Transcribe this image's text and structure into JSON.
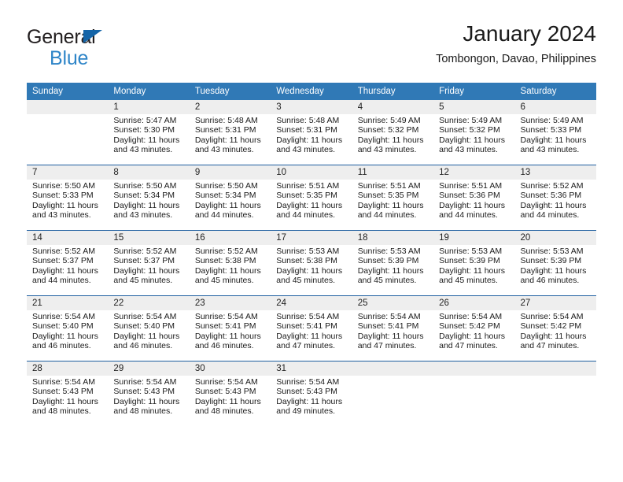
{
  "logo": {
    "word1": "General",
    "word2": "Blue",
    "triangle_icon": "blue-triangle-icon",
    "color_dark": "#231f20",
    "color_blue": "#2e85c8"
  },
  "header": {
    "title": "January 2024",
    "subtitle": "Tombongon, Davao, Philippines"
  },
  "theme": {
    "header_bg": "#3079b6",
    "separator": "#1f5fa0",
    "daynum_bg": "#eeeeee",
    "cell_bg": "#ffffff"
  },
  "calendar": {
    "weekdays": [
      "Sunday",
      "Monday",
      "Tuesday",
      "Wednesday",
      "Thursday",
      "Friday",
      "Saturday"
    ],
    "labels": {
      "sunrise": "Sunrise:",
      "sunset": "Sunset:",
      "daylight": "Daylight:"
    },
    "weeks": [
      [
        {
          "day": "",
          "sunrise": "",
          "sunset": "",
          "daylight1": "",
          "daylight2": ""
        },
        {
          "day": "1",
          "sunrise": "Sunrise: 5:47 AM",
          "sunset": "Sunset: 5:30 PM",
          "daylight1": "Daylight: 11 hours",
          "daylight2": "and 43 minutes."
        },
        {
          "day": "2",
          "sunrise": "Sunrise: 5:48 AM",
          "sunset": "Sunset: 5:31 PM",
          "daylight1": "Daylight: 11 hours",
          "daylight2": "and 43 minutes."
        },
        {
          "day": "3",
          "sunrise": "Sunrise: 5:48 AM",
          "sunset": "Sunset: 5:31 PM",
          "daylight1": "Daylight: 11 hours",
          "daylight2": "and 43 minutes."
        },
        {
          "day": "4",
          "sunrise": "Sunrise: 5:49 AM",
          "sunset": "Sunset: 5:32 PM",
          "daylight1": "Daylight: 11 hours",
          "daylight2": "and 43 minutes."
        },
        {
          "day": "5",
          "sunrise": "Sunrise: 5:49 AM",
          "sunset": "Sunset: 5:32 PM",
          "daylight1": "Daylight: 11 hours",
          "daylight2": "and 43 minutes."
        },
        {
          "day": "6",
          "sunrise": "Sunrise: 5:49 AM",
          "sunset": "Sunset: 5:33 PM",
          "daylight1": "Daylight: 11 hours",
          "daylight2": "and 43 minutes."
        }
      ],
      [
        {
          "day": "7",
          "sunrise": "Sunrise: 5:50 AM",
          "sunset": "Sunset: 5:33 PM",
          "daylight1": "Daylight: 11 hours",
          "daylight2": "and 43 minutes."
        },
        {
          "day": "8",
          "sunrise": "Sunrise: 5:50 AM",
          "sunset": "Sunset: 5:34 PM",
          "daylight1": "Daylight: 11 hours",
          "daylight2": "and 43 minutes."
        },
        {
          "day": "9",
          "sunrise": "Sunrise: 5:50 AM",
          "sunset": "Sunset: 5:34 PM",
          "daylight1": "Daylight: 11 hours",
          "daylight2": "and 44 minutes."
        },
        {
          "day": "10",
          "sunrise": "Sunrise: 5:51 AM",
          "sunset": "Sunset: 5:35 PM",
          "daylight1": "Daylight: 11 hours",
          "daylight2": "and 44 minutes."
        },
        {
          "day": "11",
          "sunrise": "Sunrise: 5:51 AM",
          "sunset": "Sunset: 5:35 PM",
          "daylight1": "Daylight: 11 hours",
          "daylight2": "and 44 minutes."
        },
        {
          "day": "12",
          "sunrise": "Sunrise: 5:51 AM",
          "sunset": "Sunset: 5:36 PM",
          "daylight1": "Daylight: 11 hours",
          "daylight2": "and 44 minutes."
        },
        {
          "day": "13",
          "sunrise": "Sunrise: 5:52 AM",
          "sunset": "Sunset: 5:36 PM",
          "daylight1": "Daylight: 11 hours",
          "daylight2": "and 44 minutes."
        }
      ],
      [
        {
          "day": "14",
          "sunrise": "Sunrise: 5:52 AM",
          "sunset": "Sunset: 5:37 PM",
          "daylight1": "Daylight: 11 hours",
          "daylight2": "and 44 minutes."
        },
        {
          "day": "15",
          "sunrise": "Sunrise: 5:52 AM",
          "sunset": "Sunset: 5:37 PM",
          "daylight1": "Daylight: 11 hours",
          "daylight2": "and 45 minutes."
        },
        {
          "day": "16",
          "sunrise": "Sunrise: 5:52 AM",
          "sunset": "Sunset: 5:38 PM",
          "daylight1": "Daylight: 11 hours",
          "daylight2": "and 45 minutes."
        },
        {
          "day": "17",
          "sunrise": "Sunrise: 5:53 AM",
          "sunset": "Sunset: 5:38 PM",
          "daylight1": "Daylight: 11 hours",
          "daylight2": "and 45 minutes."
        },
        {
          "day": "18",
          "sunrise": "Sunrise: 5:53 AM",
          "sunset": "Sunset: 5:39 PM",
          "daylight1": "Daylight: 11 hours",
          "daylight2": "and 45 minutes."
        },
        {
          "day": "19",
          "sunrise": "Sunrise: 5:53 AM",
          "sunset": "Sunset: 5:39 PM",
          "daylight1": "Daylight: 11 hours",
          "daylight2": "and 45 minutes."
        },
        {
          "day": "20",
          "sunrise": "Sunrise: 5:53 AM",
          "sunset": "Sunset: 5:39 PM",
          "daylight1": "Daylight: 11 hours",
          "daylight2": "and 46 minutes."
        }
      ],
      [
        {
          "day": "21",
          "sunrise": "Sunrise: 5:54 AM",
          "sunset": "Sunset: 5:40 PM",
          "daylight1": "Daylight: 11 hours",
          "daylight2": "and 46 minutes."
        },
        {
          "day": "22",
          "sunrise": "Sunrise: 5:54 AM",
          "sunset": "Sunset: 5:40 PM",
          "daylight1": "Daylight: 11 hours",
          "daylight2": "and 46 minutes."
        },
        {
          "day": "23",
          "sunrise": "Sunrise: 5:54 AM",
          "sunset": "Sunset: 5:41 PM",
          "daylight1": "Daylight: 11 hours",
          "daylight2": "and 46 minutes."
        },
        {
          "day": "24",
          "sunrise": "Sunrise: 5:54 AM",
          "sunset": "Sunset: 5:41 PM",
          "daylight1": "Daylight: 11 hours",
          "daylight2": "and 47 minutes."
        },
        {
          "day": "25",
          "sunrise": "Sunrise: 5:54 AM",
          "sunset": "Sunset: 5:41 PM",
          "daylight1": "Daylight: 11 hours",
          "daylight2": "and 47 minutes."
        },
        {
          "day": "26",
          "sunrise": "Sunrise: 5:54 AM",
          "sunset": "Sunset: 5:42 PM",
          "daylight1": "Daylight: 11 hours",
          "daylight2": "and 47 minutes."
        },
        {
          "day": "27",
          "sunrise": "Sunrise: 5:54 AM",
          "sunset": "Sunset: 5:42 PM",
          "daylight1": "Daylight: 11 hours",
          "daylight2": "and 47 minutes."
        }
      ],
      [
        {
          "day": "28",
          "sunrise": "Sunrise: 5:54 AM",
          "sunset": "Sunset: 5:43 PM",
          "daylight1": "Daylight: 11 hours",
          "daylight2": "and 48 minutes."
        },
        {
          "day": "29",
          "sunrise": "Sunrise: 5:54 AM",
          "sunset": "Sunset: 5:43 PM",
          "daylight1": "Daylight: 11 hours",
          "daylight2": "and 48 minutes."
        },
        {
          "day": "30",
          "sunrise": "Sunrise: 5:54 AM",
          "sunset": "Sunset: 5:43 PM",
          "daylight1": "Daylight: 11 hours",
          "daylight2": "and 48 minutes."
        },
        {
          "day": "31",
          "sunrise": "Sunrise: 5:54 AM",
          "sunset": "Sunset: 5:43 PM",
          "daylight1": "Daylight: 11 hours",
          "daylight2": "and 49 minutes."
        },
        {
          "day": "",
          "sunrise": "",
          "sunset": "",
          "daylight1": "",
          "daylight2": ""
        },
        {
          "day": "",
          "sunrise": "",
          "sunset": "",
          "daylight1": "",
          "daylight2": ""
        },
        {
          "day": "",
          "sunrise": "",
          "sunset": "",
          "daylight1": "",
          "daylight2": ""
        }
      ]
    ]
  }
}
